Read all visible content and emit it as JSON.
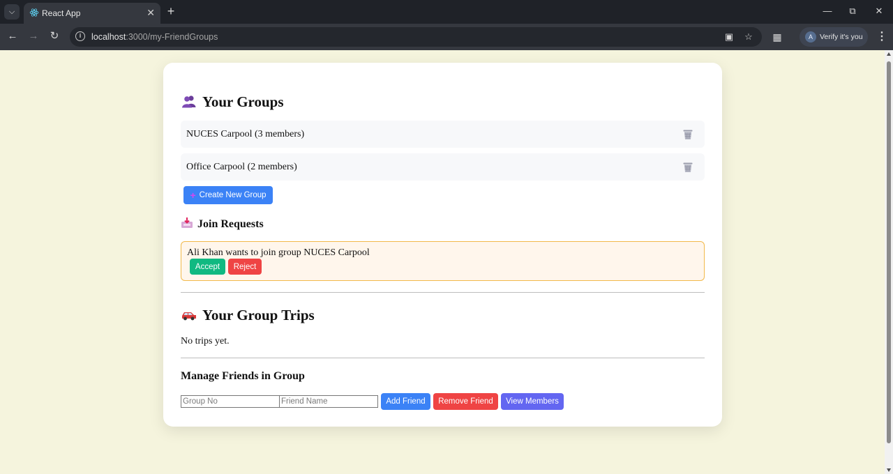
{
  "browser": {
    "tab_title": "React App",
    "url_host": "localhost",
    "url_path": ":3000/my-FriendGroups",
    "profile_initial": "A",
    "profile_label": "Verify it's you"
  },
  "groups_section": {
    "icon": "busts-icon",
    "title": "Your Groups",
    "groups": [
      {
        "label": "NUCES Carpool (3 members)"
      },
      {
        "label": "Office Carpool (2 members)"
      }
    ],
    "create_button": "Create New Group"
  },
  "join_requests": {
    "icon": "inbox-tray-icon",
    "title": "Join Requests",
    "requests": [
      {
        "text": "Ali Khan wants to join group NUCES Carpool",
        "accept_label": "Accept",
        "reject_label": "Reject"
      }
    ]
  },
  "trips_section": {
    "icon": "car-icon",
    "title": "Your Group Trips",
    "empty_text": "No trips yet."
  },
  "manage_section": {
    "title": "Manage Friends in Group",
    "group_no_placeholder": "Group No",
    "friend_name_placeholder": "Friend Name",
    "add_label": "Add Friend",
    "remove_label": "Remove Friend",
    "view_label": "View Members"
  },
  "colors": {
    "page_background": "#f5f4dd",
    "primary_blue": "#3b82f6",
    "accept_green": "#10b981",
    "reject_red": "#ef4444",
    "view_indigo": "#6366f1",
    "request_border": "#f2b94a"
  }
}
